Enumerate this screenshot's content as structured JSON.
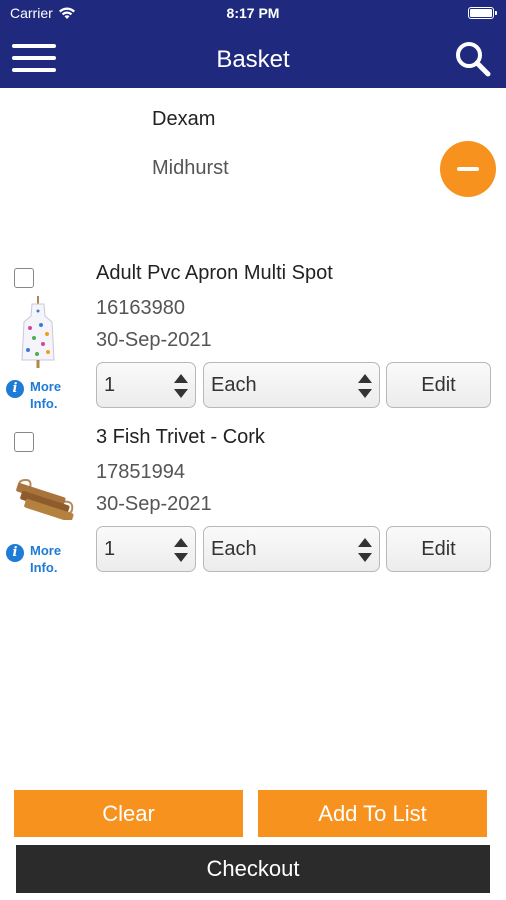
{
  "status_bar": {
    "carrier": "Carrier",
    "time": "8:17 PM"
  },
  "nav": {
    "title": "Basket"
  },
  "supplier": {
    "name": "Dexam",
    "branch": "Midhurst"
  },
  "products": [
    {
      "name": "Adult Pvc Apron Multi Spot",
      "code": "16163980",
      "date": "30-Sep-2021",
      "quantity": "1",
      "unit": "Each",
      "edit_label": "Edit",
      "more_info_label": "More Info.",
      "image": "apron-image",
      "checked": false
    },
    {
      "name": "3 Fish Trivet - Cork",
      "code": "17851994",
      "date": "30-Sep-2021",
      "quantity": "1",
      "unit": "Each",
      "edit_label": "Edit",
      "more_info_label": "More Info.",
      "image": "trivet-image",
      "checked": false
    }
  ],
  "actions": {
    "clear_label": "Clear",
    "add_to_list_label": "Add To List",
    "checkout_label": "Checkout"
  },
  "colors": {
    "nav_bg": "#1f2a7f",
    "accent_orange": "#f7921e",
    "info_blue": "#1e7bd6",
    "checkout_bg": "#2b2b2b"
  },
  "icons": {
    "menu": "menu-icon",
    "search": "search-icon",
    "remove": "minus-circle-icon",
    "info": "info-icon",
    "wifi": "wifi-icon",
    "battery": "battery-icon"
  }
}
